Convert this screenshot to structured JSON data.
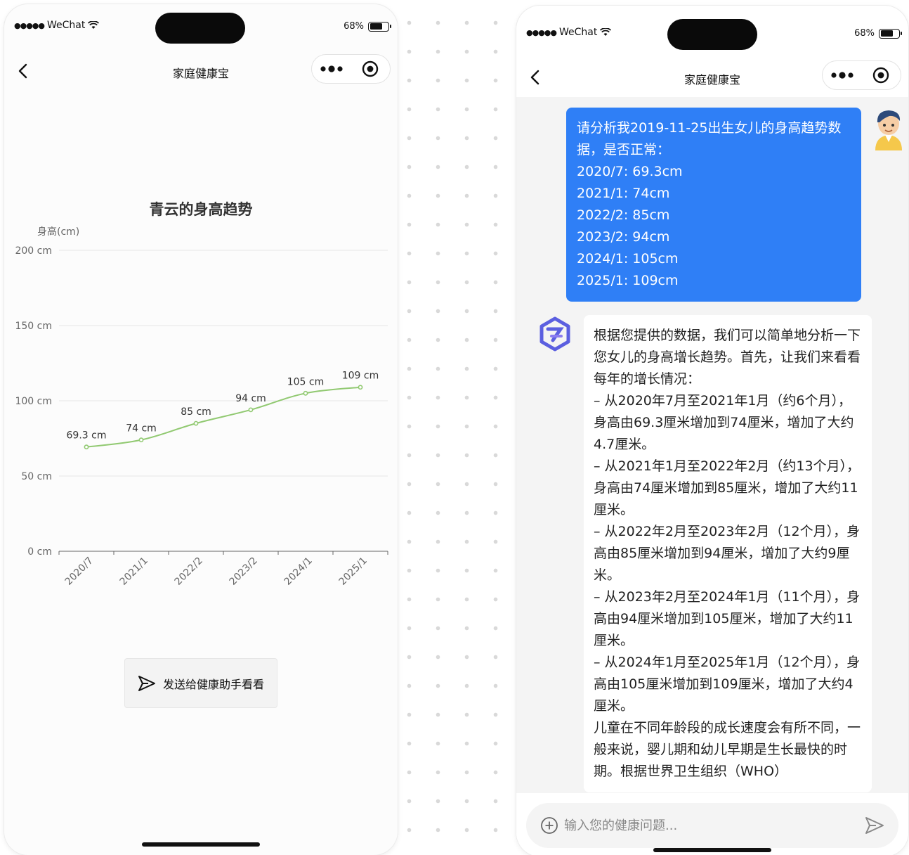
{
  "left_phone": {
    "status": {
      "carrier": "WeChat",
      "battery": "68%",
      "battery_level": 0.68
    },
    "nav": {
      "title": "家庭健康宝",
      "back_icon": "chevron-left-icon",
      "more_icon": "more-dots-icon",
      "close_icon": "target-icon"
    },
    "chart_title": "青云的身高趋势",
    "send_button": {
      "label": "发送给健康助手看看",
      "icon": "send-icon"
    }
  },
  "chart_data": {
    "type": "line",
    "title": "青云的身高趋势",
    "ylabel": "身高(cm)",
    "categories": [
      "2020/7",
      "2021/1",
      "2022/2",
      "2023/2",
      "2024/1",
      "2025/1"
    ],
    "values": [
      69.3,
      74,
      85,
      94,
      105,
      109
    ],
    "data_labels": [
      "69.3 cm",
      "74 cm",
      "85 cm",
      "94 cm",
      "105 cm",
      "109 cm"
    ],
    "y_ticks": [
      0,
      50,
      100,
      150,
      200
    ],
    "y_tick_labels": [
      "0 cm",
      "50 cm",
      "100 cm",
      "150 cm",
      "200 cm"
    ],
    "ylim": [
      0,
      200
    ],
    "grid": true,
    "line_color": "#91c971"
  },
  "right_phone": {
    "status": {
      "carrier": "WeChat",
      "battery": "68%",
      "battery_level": 0.68
    },
    "nav": {
      "title": "家庭健康宝"
    },
    "user_message": [
      "请分析我2019-11-25出生女儿的身高趋势数据，是否正常：",
      "2020/7: 69.3cm",
      "2021/1: 74cm",
      "2022/2: 85cm",
      "2023/2: 94cm",
      "2024/1: 105cm",
      "2025/1: 109cm"
    ],
    "bot_message": [
      "根据您提供的数据，我们可以简单地分析一下您女儿的身高增长趋势。首先，让我们来看看每年的增长情况：",
      "– 从2020年7月至2021年1月（约6个月），身高由69.3厘米增加到74厘米，增加了大约4.7厘米。",
      "– 从2021年1月至2022年2月（约13个月），身高由74厘米增加到85厘米，增加了大约11厘米。",
      "– 从2022年2月至2023年2月（12个月），身高由85厘米增加到94厘米，增加了大约9厘米。",
      "– 从2023年2月至2024年1月（11个月），身高由94厘米增加到105厘米，增加了大约11厘米。",
      "– 从2024年1月至2025年1月（12个月），身高由105厘米增加到109厘米，增加了大约4厘米。",
      "儿童在不同年龄段的成长速度会有所不同，一般来说，婴儿期和幼儿早期是生长最快的时期。根据世界卫生组织（WHO）"
    ],
    "input": {
      "placeholder": "输入您的健康问题..."
    },
    "colors": {
      "user_bubble": "#2f7ff6",
      "chat_bg": "#f4f4f4"
    }
  }
}
